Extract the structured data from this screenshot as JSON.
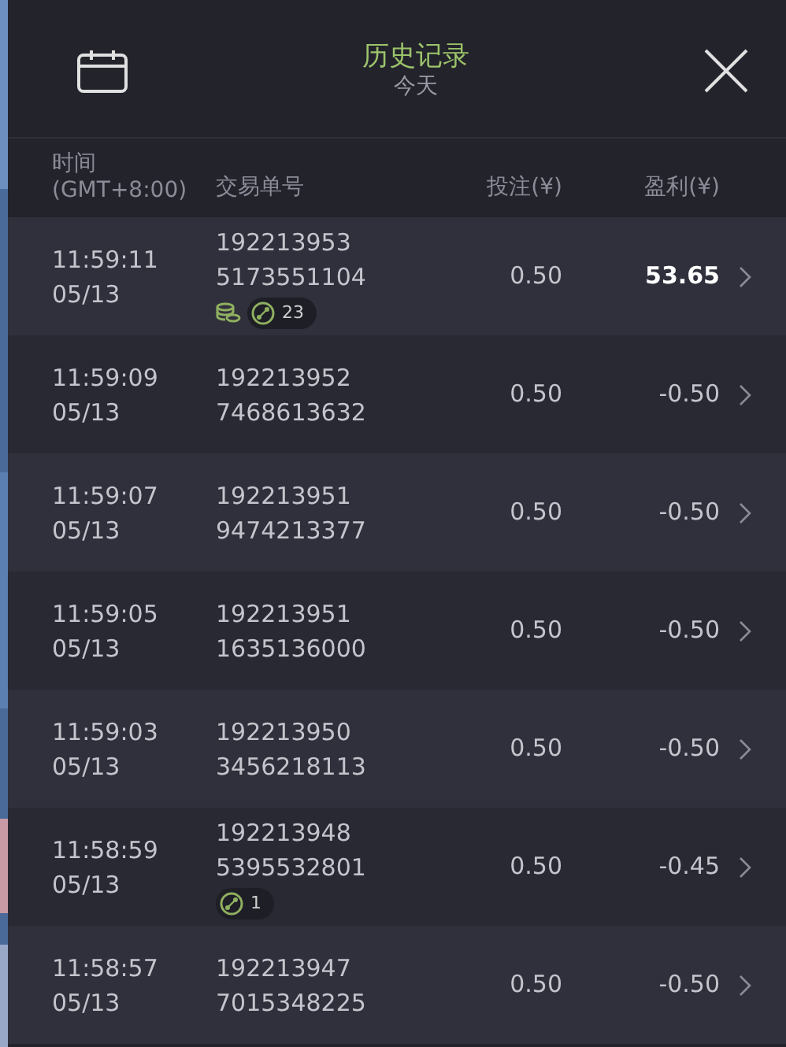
{
  "header": {
    "title": "历史记录",
    "subtitle": "今天"
  },
  "columns": [
    {
      "label": "时间\n(GMT+8:00)"
    },
    {
      "label": "交易单号"
    },
    {
      "label": "投注(¥)"
    },
    {
      "label": "盈利(¥)"
    }
  ],
  "rows": [
    {
      "time": "11:59:11",
      "date": "05/13",
      "id_1": "192213953",
      "id_2": "5173551104",
      "stake": "0.50",
      "profit": "53.65",
      "positive": true,
      "badges": [
        {
          "kind": "coins"
        },
        {
          "kind": "bonus",
          "count": "23"
        }
      ]
    },
    {
      "time": "11:59:09",
      "date": "05/13",
      "id_1": "192213952",
      "id_2": "7468613632",
      "stake": "0.50",
      "profit": "-0.50",
      "positive": false
    },
    {
      "time": "11:59:07",
      "date": "05/13",
      "id_1": "192213951",
      "id_2": "9474213377",
      "stake": "0.50",
      "profit": "-0.50",
      "positive": false
    },
    {
      "time": "11:59:05",
      "date": "05/13",
      "id_1": "192213951",
      "id_2": "1635136000",
      "stake": "0.50",
      "profit": "-0.50",
      "positive": false
    },
    {
      "time": "11:59:03",
      "date": "05/13",
      "id_1": "192213950",
      "id_2": "3456218113",
      "stake": "0.50",
      "profit": "-0.50",
      "positive": false
    },
    {
      "time": "11:58:59",
      "date": "05/13",
      "id_1": "192213948",
      "id_2": "5395532801",
      "stake": "0.50",
      "profit": "-0.45",
      "positive": false,
      "badges": [
        {
          "kind": "bonus",
          "count": "1"
        }
      ]
    },
    {
      "time": "11:58:57",
      "date": "05/13",
      "id_1": "192213947",
      "id_2": "7015348225",
      "stake": "0.50",
      "profit": "-0.50",
      "positive": false
    }
  ]
}
